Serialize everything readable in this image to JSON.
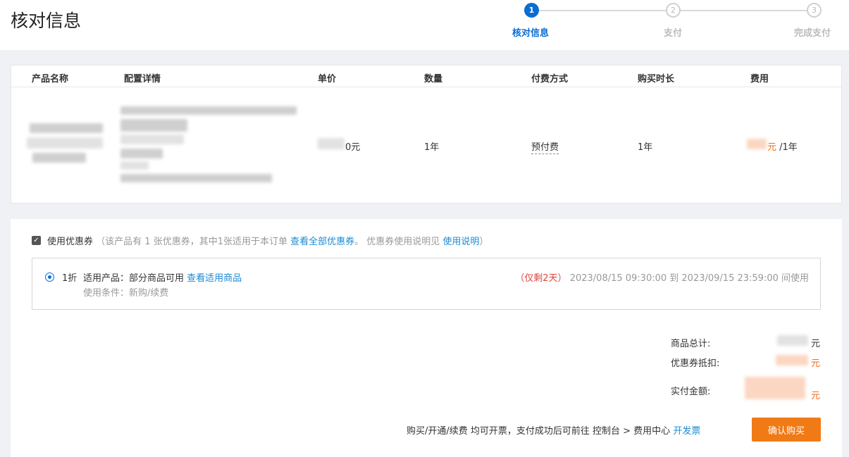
{
  "page_title": "核对信息",
  "steps": [
    {
      "num": "1",
      "label": "核对信息"
    },
    {
      "num": "2",
      "label": "支付"
    },
    {
      "num": "3",
      "label": "完成支付"
    }
  ],
  "table": {
    "headers": [
      "产品名称",
      "配置详情",
      "单价",
      "数量",
      "付费方式",
      "购买时长",
      "费用"
    ],
    "row": {
      "price_suffix": "0元",
      "quantity": "1年",
      "pay_mode": "预付费",
      "duration": "1年",
      "fee_unit": "元",
      "fee_period": "/1年"
    }
  },
  "coupon": {
    "checkbox_mark": "✓",
    "use_label": "使用优惠券",
    "info_prefix": "（该产品有 1 张优惠券，其中1张适用于本订单",
    "view_all_link": "查看全部优惠券",
    "info_mid": "。 优惠券使用说明见",
    "usage_link": "使用说明",
    "info_suffix": "）",
    "item": {
      "discount": "1折",
      "scope_label": "适用产品：部分商品可用",
      "scope_link": "查看适用商品",
      "condition": "使用条件：新购/续费",
      "remaining": "（仅剩2天）",
      "validity": "2023/08/15 09:30:00 到 2023/09/15 23:59:00 间使用"
    }
  },
  "summary": {
    "total_label": "商品总计:",
    "total_unit": "元",
    "coupon_label": "优惠券抵扣:",
    "coupon_unit": "元",
    "paid_label": "实付金额:",
    "paid_unit": "元"
  },
  "footer": {
    "note": "购买/开通/续费 均可开票，支付成功后可前往 控制台 > 费用中心",
    "invoice_link": "开发票",
    "confirm_label": "确认购买"
  },
  "colors": {
    "primary": "#0b6cd1",
    "link": "#1a8ad4",
    "accent": "#f07a15",
    "warning": "#e0443a"
  }
}
